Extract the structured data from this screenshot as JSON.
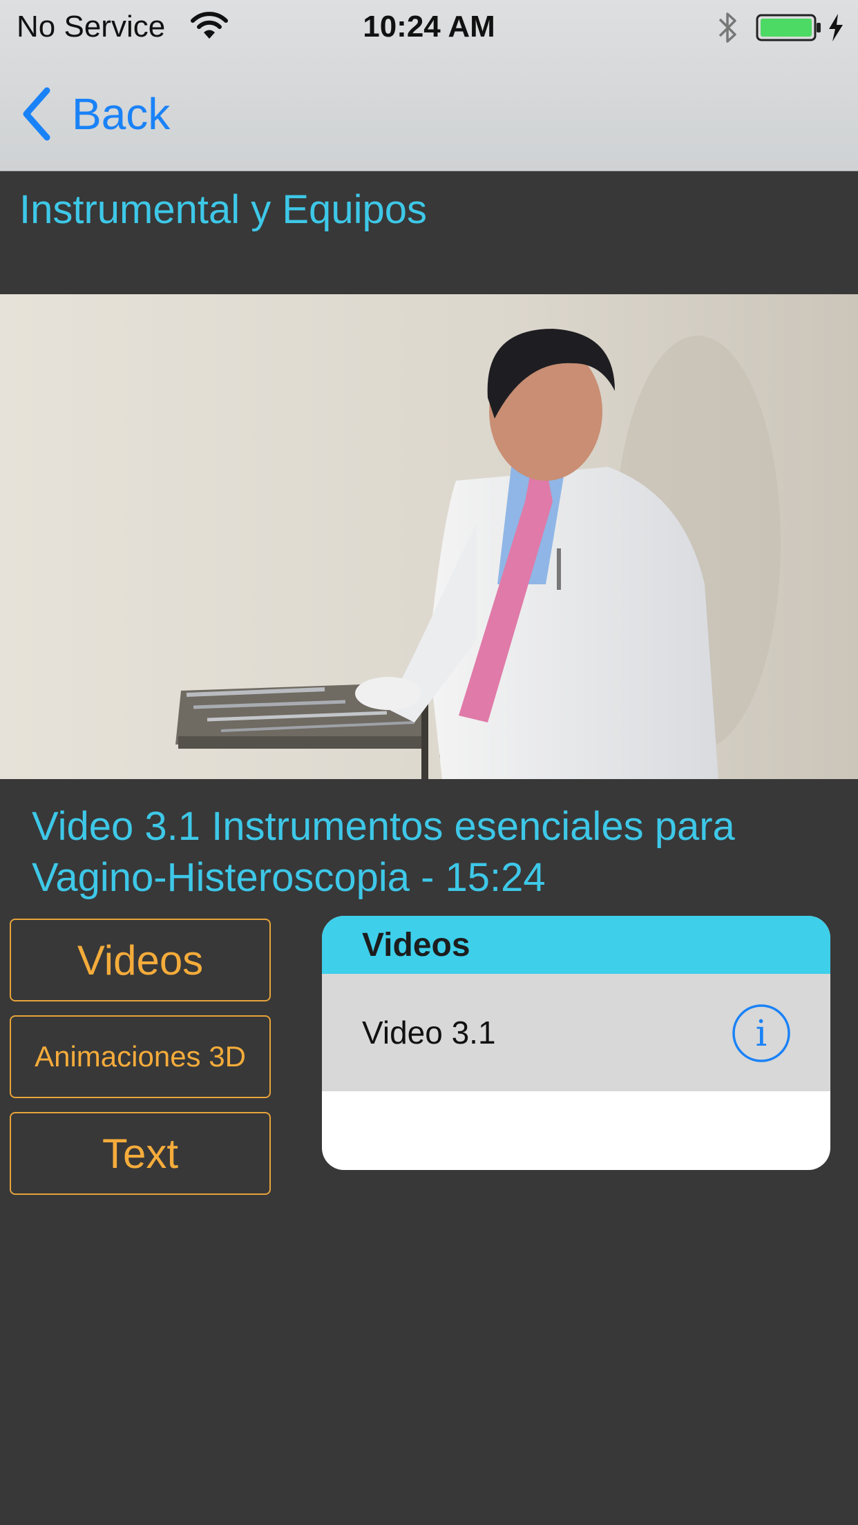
{
  "status_bar": {
    "carrier": "No Service",
    "time": "10:24 AM",
    "icons": [
      "wifi-icon",
      "bluetooth-icon",
      "battery-icon",
      "charging-icon"
    ],
    "battery_color": "#4cd964"
  },
  "nav": {
    "back_label": "Back",
    "back_icon": "chevron-left-icon"
  },
  "page": {
    "title": "Instrumental y Equipos"
  },
  "video": {
    "caption": "Video 3.1 Instrumentos esenciales para Vagino-Histeroscopia - 15:24"
  },
  "sections": [
    {
      "label": "Videos"
    },
    {
      "label": "Animaciones 3D"
    },
    {
      "label": "Text"
    }
  ],
  "list": {
    "header": "Videos",
    "items": [
      {
        "label": "Video 3.1",
        "icon": "info-icon"
      }
    ]
  },
  "colors": {
    "accent_cyan": "#3ec8e8",
    "accent_orange": "#f5ac3b",
    "link_blue": "#1a82f7",
    "background": "#383838"
  }
}
